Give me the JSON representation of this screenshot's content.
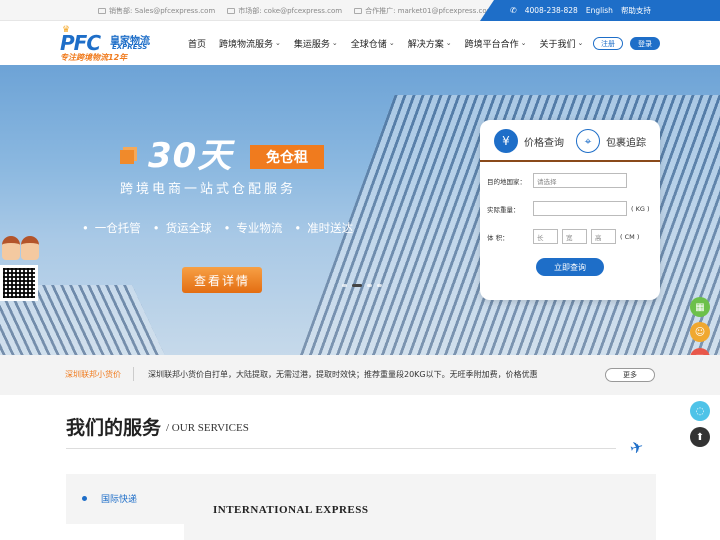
{
  "topbar": {
    "contacts": [
      {
        "label": "销售部: Sales@pfcexpress.com"
      },
      {
        "label": "市场部: coke@pfcexpress.com"
      },
      {
        "label": "合作推广: market01@pfcexpress.com"
      }
    ],
    "phone": "4008-238-828",
    "english": "English",
    "help": "帮助支持"
  },
  "logo": {
    "pfc": "PFC",
    "cn": "皇家物流",
    "en": "EXPRESS",
    "slogan": "专注跨境物流12年"
  },
  "nav": {
    "items": [
      {
        "label": "首页",
        "dropdown": false
      },
      {
        "label": "跨境物流服务",
        "dropdown": true
      },
      {
        "label": "集运服务",
        "dropdown": true
      },
      {
        "label": "全球仓储",
        "dropdown": true
      },
      {
        "label": "解决方案",
        "dropdown": true
      },
      {
        "label": "跨境平台合作",
        "dropdown": true
      },
      {
        "label": "关于我们",
        "dropdown": true
      }
    ],
    "register": "注册",
    "login": "登录"
  },
  "banner": {
    "headline": "30天",
    "tag": "免仓租",
    "subtitle": "跨境电商一站式仓配服务",
    "bullets": [
      "一仓托管",
      "货运全球",
      "专业物流",
      "准时送达"
    ],
    "cta": "查看详情"
  },
  "query": {
    "tab_price": "价格查询",
    "tab_track": "包裹追踪",
    "country_label": "目的地国家：",
    "country_placeholder": "请选择",
    "weight_label": "实际重量：",
    "weight_unit": "( KG )",
    "size_label": "体    积：",
    "length_placeholder": "长",
    "width_placeholder": "宽",
    "height_placeholder": "高",
    "size_unit": "( CM )",
    "submit": "立即查询"
  },
  "news": {
    "tag": "深圳联邦小货价",
    "text": "深圳联邦小货价自打单，大陆提取，无需过港，提取时效快；推荐重量段20KG以下。无旺季附加费，价格优惠",
    "more": "更多"
  },
  "services": {
    "title": "我们的服务",
    "title_en": "/ OUR SERVICES",
    "first_item": "国际快递",
    "first_item_en": "INTERNATIONAL EXPRESS"
  },
  "colors": {
    "brand_blue": "#1e6ec8",
    "accent_orange": "#f07b1e"
  }
}
